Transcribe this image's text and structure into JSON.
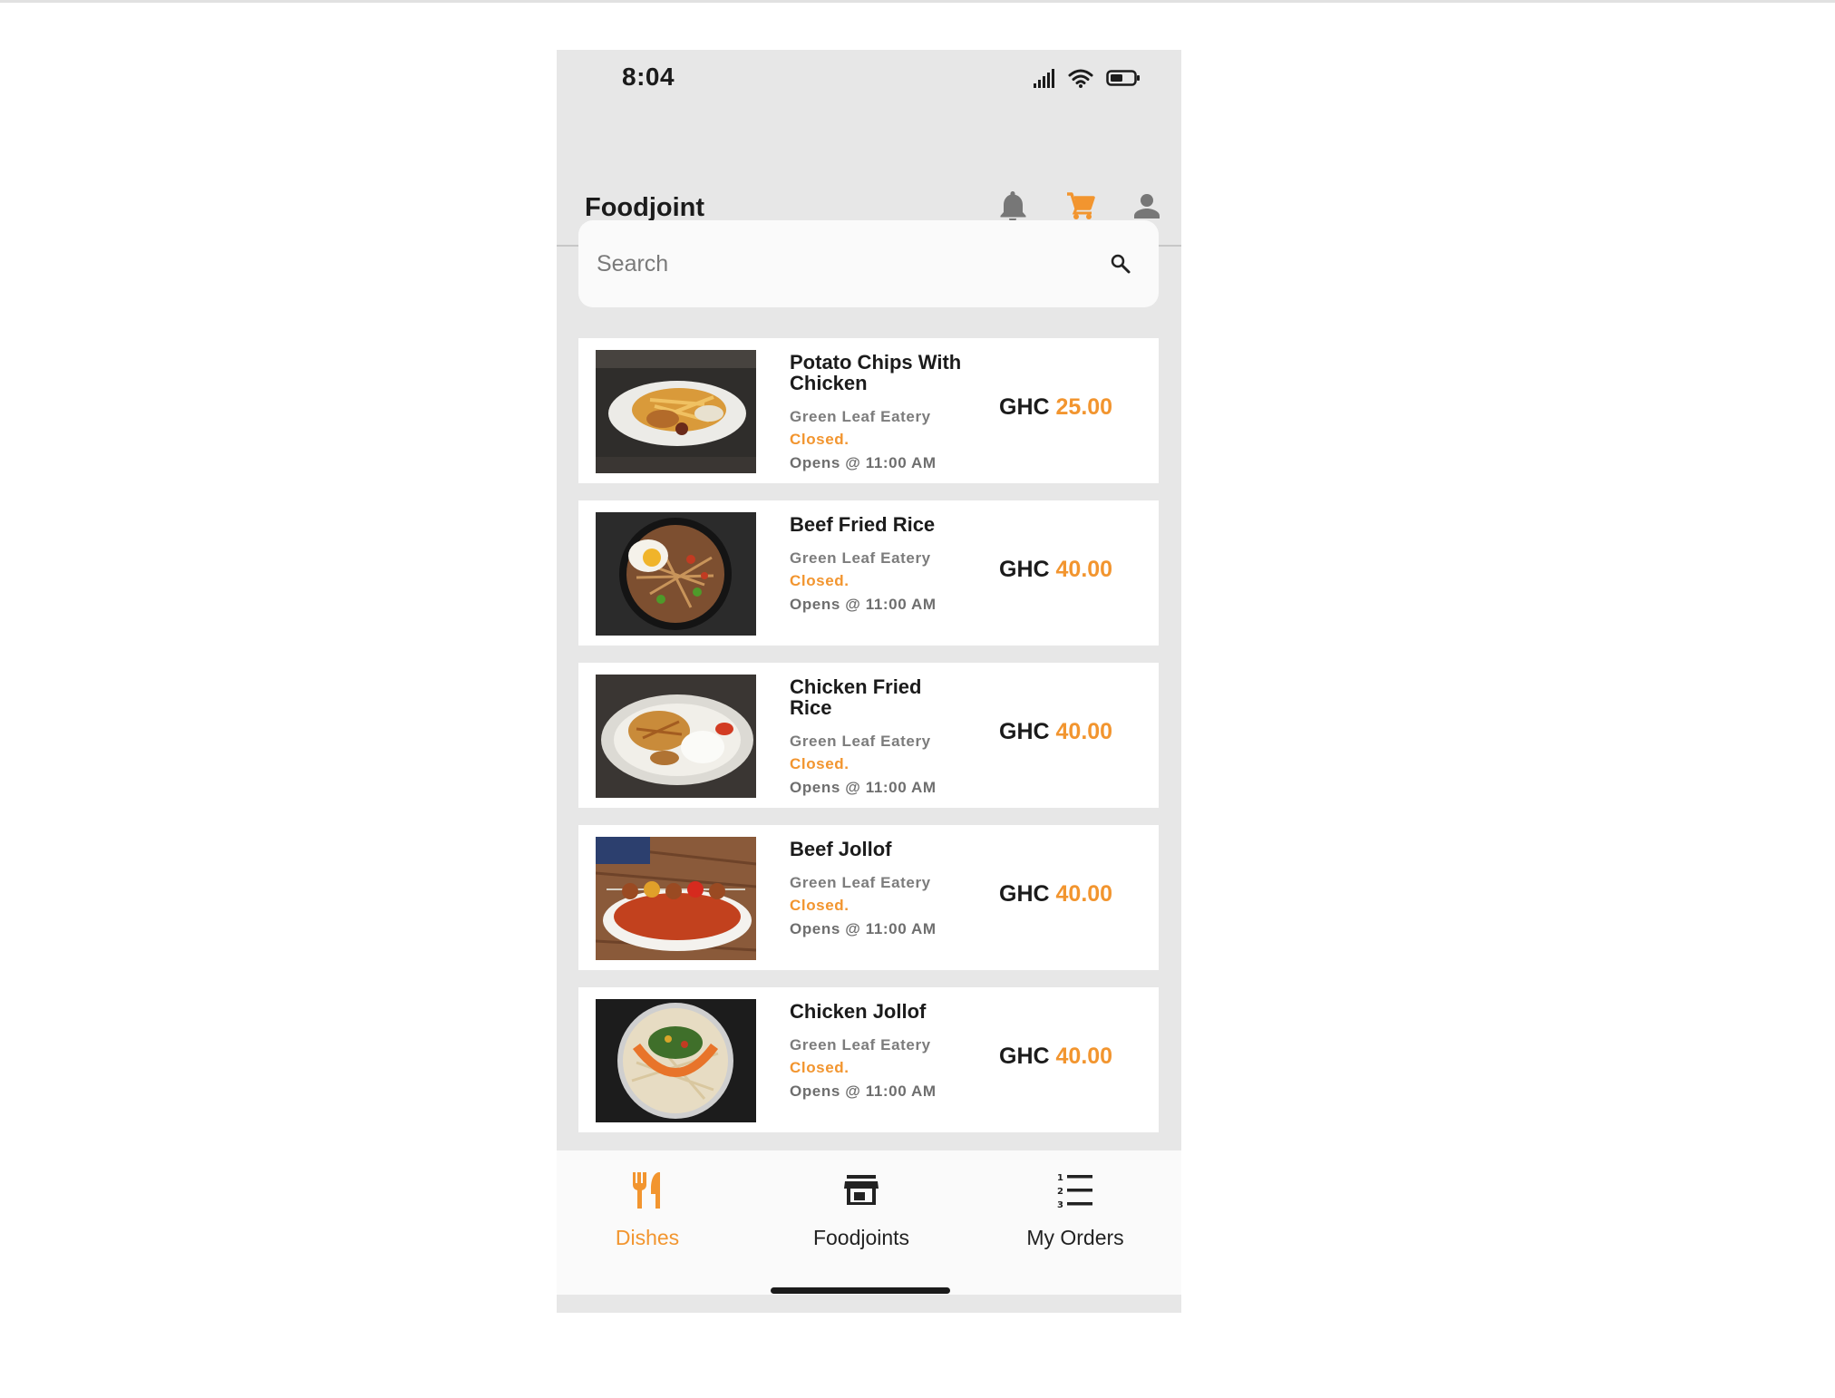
{
  "status_bar": {
    "time": "8:04"
  },
  "header": {
    "title": "Foodjoint",
    "icons": [
      "bell-icon",
      "cart-icon",
      "user-icon"
    ]
  },
  "search": {
    "placeholder": "Search"
  },
  "dishes": [
    {
      "name": "Potato Chips With Chicken",
      "eatery": "Green Leaf Eatery",
      "status": "Closed.",
      "opens": "Opens @ 11:00 AM",
      "currency": "GHC",
      "price": "25.00"
    },
    {
      "name": "Beef Fried Rice",
      "eatery": "Green Leaf Eatery",
      "status": "Closed.",
      "opens": "Opens @ 11:00 AM",
      "currency": "GHC",
      "price": "40.00"
    },
    {
      "name": "Chicken Fried Rice",
      "eatery": "Green Leaf Eatery",
      "status": "Closed.",
      "opens": "Opens @ 11:00 AM",
      "currency": "GHC",
      "price": "40.00"
    },
    {
      "name": "Beef Jollof",
      "eatery": "Green Leaf Eatery",
      "status": "Closed.",
      "opens": "Opens @ 11:00 AM",
      "currency": "GHC",
      "price": "40.00"
    },
    {
      "name": "Chicken Jollof",
      "eatery": "Green Leaf Eatery",
      "status": "Closed.",
      "opens": "Opens @ 11:00 AM",
      "currency": "GHC",
      "price": "40.00"
    }
  ],
  "bottom_nav": {
    "items": [
      {
        "label": "Dishes",
        "icon": "fork-knife-icon",
        "active": true
      },
      {
        "label": "Foodjoints",
        "icon": "storefront-icon",
        "active": false
      },
      {
        "label": "My Orders",
        "icon": "numbered-list-icon",
        "active": false
      }
    ]
  },
  "colors": {
    "accent": "#f2952f",
    "text": "#1b1b1b",
    "background": "#e7e7e7",
    "card": "#ffffff"
  }
}
